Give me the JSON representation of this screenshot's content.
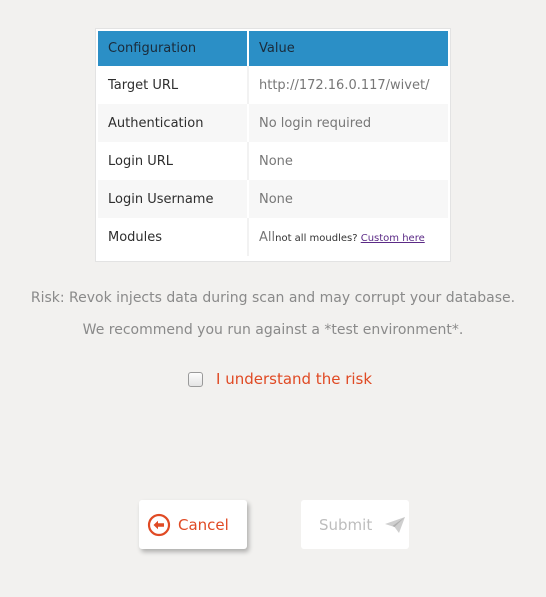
{
  "config_table": {
    "headers": {
      "configuration": "Configuration",
      "value": "Value"
    },
    "rows": [
      {
        "key": "Target URL",
        "value": "http://172.16.0.117/wivet/"
      },
      {
        "key": "Authentication",
        "value": "No login required"
      },
      {
        "key": "Login URL",
        "value": "None"
      },
      {
        "key": "Login Username",
        "value": "None"
      }
    ],
    "modules": {
      "key": "Modules",
      "value": "All",
      "note": "not all moudles? ",
      "link_text": "Custom here"
    }
  },
  "risk": {
    "line1": "Risk: Revok injects data during scan and may corrupt your database.",
    "line2": "We recommend you run against a *test environment*.",
    "checkbox_label": "I understand the risk",
    "checked": false
  },
  "buttons": {
    "cancel_label": "Cancel",
    "submit_label": "Submit"
  },
  "colors": {
    "header_bg": "#2b8fc6",
    "accent_red": "#e04a24",
    "link": "#5b2a86"
  },
  "icons": {
    "cancel": "arrow-left-circle-icon",
    "submit": "paper-plane-icon"
  }
}
